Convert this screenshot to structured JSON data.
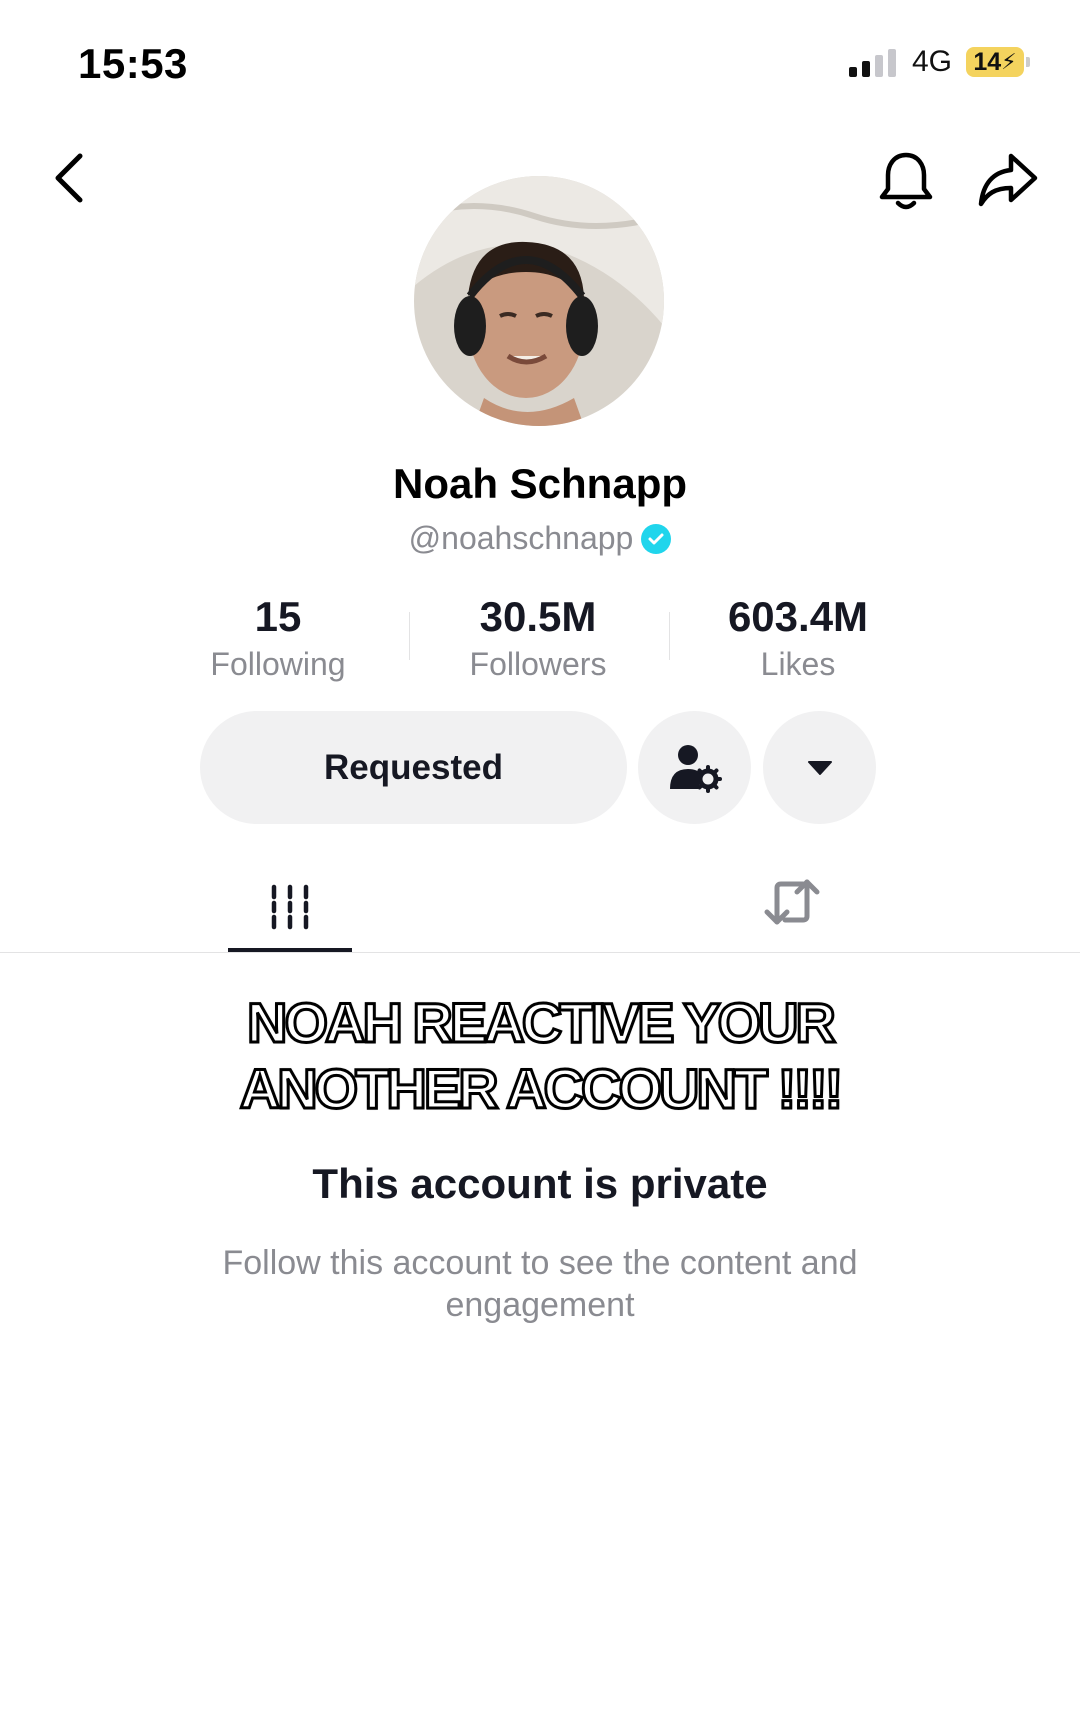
{
  "status_bar": {
    "time": "15:53",
    "network": "4G",
    "battery": "14"
  },
  "top_bar": {
    "back_icon": "chevron-left-icon",
    "notification_icon": "bell-icon",
    "share_icon": "share-arrow-icon"
  },
  "profile": {
    "display_name": "Noah Schnapp",
    "username": "@noahschnapp",
    "verified": true,
    "stats": [
      {
        "value": "15",
        "label": "Following"
      },
      {
        "value": "30.5M",
        "label": "Followers"
      },
      {
        "value": "603.4M",
        "label": "Likes"
      }
    ]
  },
  "actions": {
    "follow_state_label": "Requested",
    "user_settings_icon": "user-gear-icon",
    "more_icon": "caret-down-icon"
  },
  "tabs": {
    "videos_icon": "grid-icon",
    "reposts_icon": "repost-icon"
  },
  "overlay_caption": {
    "line1": "NOAH REACTIVE YOUR",
    "line2": "ANOTHER ACCOUNT !!!!"
  },
  "private_notice": {
    "title": "This account is private",
    "subtitle": "Follow this account to see the content and engagement"
  },
  "colors": {
    "verified_badge": "#20d5ec",
    "battery_fill": "#f4d35e",
    "button_bg": "#f1f1f2",
    "secondary_text": "#8a8b91"
  }
}
